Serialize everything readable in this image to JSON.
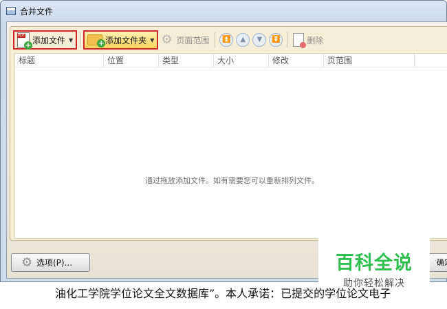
{
  "window": {
    "title": "合并文件"
  },
  "toolbar": {
    "add_files": "添加文件",
    "add_folder": "添加文件夹",
    "page_range": "页面范围",
    "delete": "删除"
  },
  "table": {
    "columns": [
      "标题",
      "位置",
      "类型",
      "大小",
      "修改",
      "页范围"
    ],
    "empty_message": "通过拖放添加文件。如有需要您可以重新排列文件。"
  },
  "footer": {
    "options": "选项(P)...",
    "ok": "确定"
  },
  "watermark": {
    "title": "百科全说",
    "subtitle": "助你轻松解决"
  },
  "document_text": "油化工学院学位论文全文数据库”。本人承诺：已提交的学位论文电子"
}
